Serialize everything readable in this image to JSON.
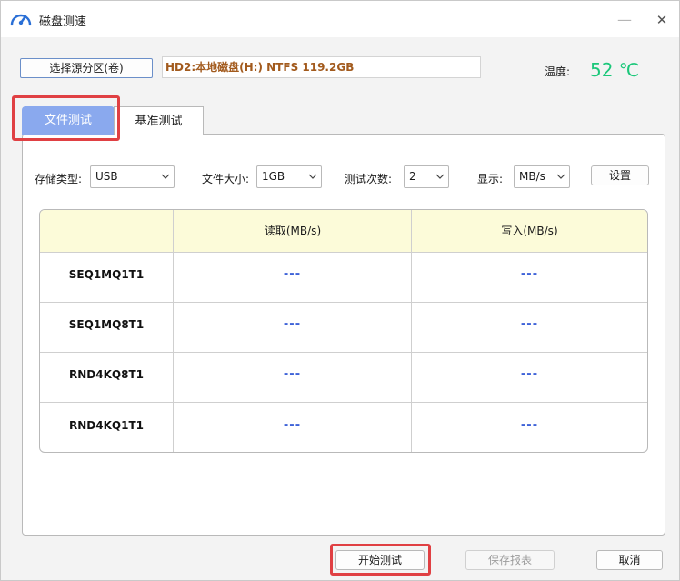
{
  "window": {
    "title": "磁盘测速",
    "minimize_glyph": "—",
    "close_glyph": "✕"
  },
  "source": {
    "select_button": "选择源分区(卷)",
    "selected_value": "HD2:本地磁盘(H:) NTFS 119.2GB"
  },
  "temperature": {
    "label": "温度:",
    "value": "52 ℃"
  },
  "tabs": [
    {
      "label": "文件测试",
      "active": true
    },
    {
      "label": "基准测试",
      "active": false
    }
  ],
  "options": {
    "storage_type": {
      "label": "存储类型:",
      "value": "USB"
    },
    "file_size": {
      "label": "文件大小:",
      "value": "1GB"
    },
    "test_count": {
      "label": "测试次数:",
      "value": "2"
    },
    "display": {
      "label": "显示:",
      "value": "MB/s"
    },
    "settings_button": "设置"
  },
  "results": {
    "columns": [
      "",
      "读取(MB/s)",
      "写入(MB/s)"
    ],
    "rows": [
      {
        "label": "SEQ1MQ1T1",
        "read": "---",
        "write": "---"
      },
      {
        "label": "SEQ1MQ8T1",
        "read": "---",
        "write": "---"
      },
      {
        "label": "RND4KQ8T1",
        "read": "---",
        "write": "---"
      },
      {
        "label": "RND4KQ1T1",
        "read": "---",
        "write": "---"
      }
    ]
  },
  "footer": {
    "start_button": "开始测试",
    "save_button": "保存报表",
    "cancel_button": "取消"
  },
  "colors": {
    "active_tab": "#8aa9ee",
    "temperature": "#1bc77a",
    "highlight": "#e04043",
    "header_row": "#fcfbd9",
    "placeholder": "#3f63d8",
    "disk_text": "#a25a1d"
  },
  "icons": {
    "app": "speedometer-icon",
    "dropdown": "chevron-down-icon"
  }
}
